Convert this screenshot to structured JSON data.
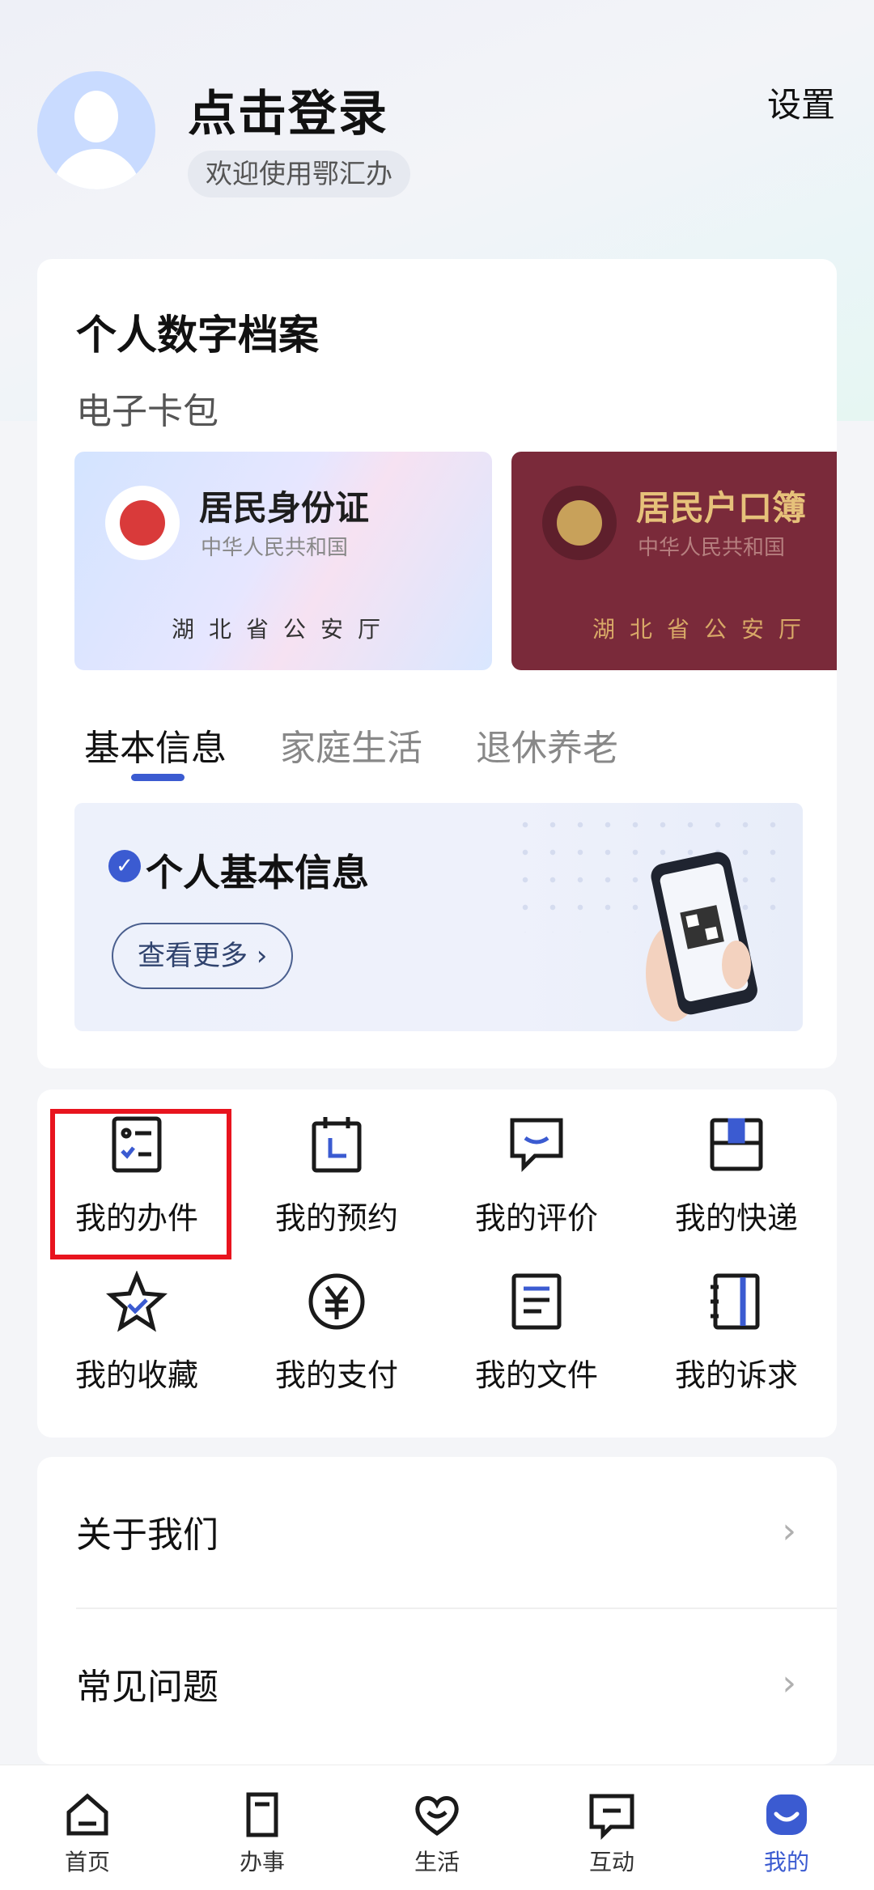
{
  "header": {
    "login_title": "点击登录",
    "welcome": "欢迎使用鄂汇办",
    "settings": "设置"
  },
  "archive": {
    "title": "个人数字档案",
    "wallet_label": "电子卡包",
    "cards": [
      {
        "name": "居民身份证",
        "country": "中华人民共和国",
        "issuer": "湖北省公安厅"
      },
      {
        "name": "居民户口簿",
        "country": "中华人民共和国",
        "issuer": "湖北省公安厅"
      }
    ],
    "tabs": [
      "基本信息",
      "家庭生活",
      "退休养老"
    ],
    "active_tab": 0,
    "info_panel": {
      "title": "个人基本信息",
      "more_button": "查看更多"
    }
  },
  "services": [
    {
      "label": "我的办件",
      "icon": "task-list-icon"
    },
    {
      "label": "我的预约",
      "icon": "calendar-icon"
    },
    {
      "label": "我的评价",
      "icon": "comment-icon"
    },
    {
      "label": "我的快递",
      "icon": "package-icon"
    },
    {
      "label": "我的收藏",
      "icon": "star-icon"
    },
    {
      "label": "我的支付",
      "icon": "yuan-icon"
    },
    {
      "label": "我的文件",
      "icon": "document-icon"
    },
    {
      "label": "我的诉求",
      "icon": "notebook-icon"
    }
  ],
  "menu": [
    {
      "label": "关于我们"
    },
    {
      "label": "常见问题"
    }
  ],
  "tabbar": [
    {
      "label": "首页",
      "icon": "home-icon"
    },
    {
      "label": "办事",
      "icon": "bookmark-icon"
    },
    {
      "label": "生活",
      "icon": "heart-icon"
    },
    {
      "label": "互动",
      "icon": "chat-icon"
    },
    {
      "label": "我的",
      "icon": "profile-icon"
    }
  ],
  "tabbar_active": 4,
  "colors": {
    "accent": "#3b5bd1",
    "highlight_border": "#e8141e",
    "household_card": "#7a2a3a",
    "avatar_bg": "#c9dbff"
  }
}
